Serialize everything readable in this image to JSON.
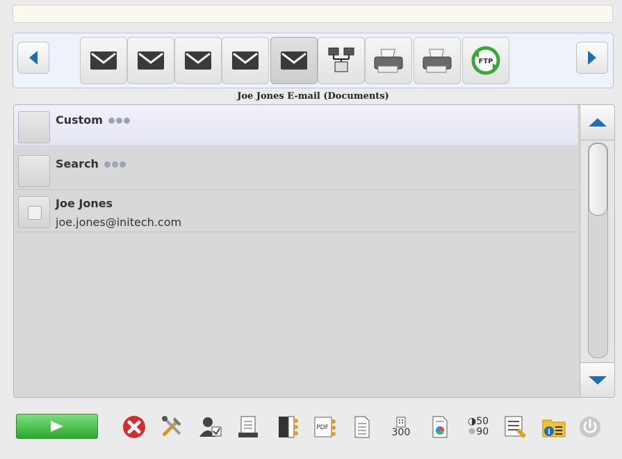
{
  "status_bar": {
    "text": ""
  },
  "carousel": {
    "prev_icon": "left-arrow-icon",
    "next_icon": "right-arrow-icon",
    "destinations": [
      {
        "icon": "email-envelope-icon",
        "selected": false
      },
      {
        "icon": "email-envelope-icon",
        "selected": false
      },
      {
        "icon": "email-envelope-icon",
        "selected": false
      },
      {
        "icon": "email-envelope-icon",
        "selected": false
      },
      {
        "icon": "email-envelope-icon",
        "selected": true
      },
      {
        "icon": "network-folder-icon",
        "selected": false
      },
      {
        "icon": "printer-icon",
        "selected": false
      },
      {
        "icon": "printer-icon",
        "selected": false
      },
      {
        "icon": "ftp-icon",
        "selected": false,
        "label": "FTP"
      }
    ],
    "caption": "Joe Jones E-mail (Documents)"
  },
  "list": {
    "rows": [
      {
        "title": "Custom",
        "subtitle": "",
        "has_more": true,
        "highlighted": true
      },
      {
        "title": "Search",
        "subtitle": "",
        "has_more": true,
        "highlighted": false
      },
      {
        "title": "Joe Jones",
        "subtitle": "joe.jones@initech.com",
        "has_more": false,
        "highlighted": false,
        "checkbox": true
      }
    ],
    "scroll_position": 0.0
  },
  "toolbar": {
    "start_icon": "play-icon",
    "tools": [
      {
        "name": "cancel-icon"
      },
      {
        "name": "tools-icon"
      },
      {
        "name": "user-settings-icon"
      },
      {
        "name": "scan-document-icon"
      },
      {
        "name": "multipage-icon"
      },
      {
        "name": "pdf-icon",
        "label": "PDF"
      },
      {
        "name": "page-icon"
      },
      {
        "name": "resolution-icon",
        "value": "300"
      },
      {
        "name": "color-mode-icon"
      },
      {
        "name": "contrast-icon",
        "value_top": "50",
        "value_bottom": "90"
      },
      {
        "name": "checklist-icon"
      },
      {
        "name": "info-folder-icon"
      },
      {
        "name": "power-icon"
      }
    ]
  },
  "colors": {
    "accent_blue": "#1a6fb5",
    "start_green": "#3fb43f",
    "cancel_red": "#d32f2f"
  }
}
